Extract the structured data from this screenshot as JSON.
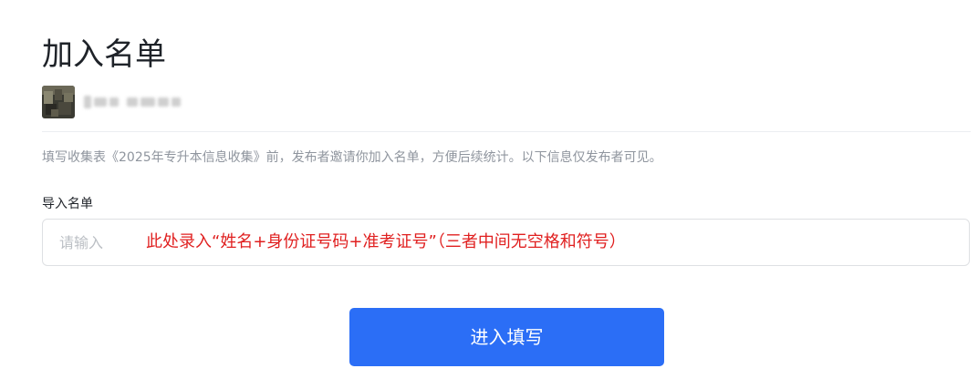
{
  "page": {
    "title": "加入名单"
  },
  "publisher": {
    "name_masked": true
  },
  "description": "填写收集表《2025年专升本信息收集》前，发布者邀请你加入名单，方便后续统计。以下信息仅发布者可见。",
  "field": {
    "label": "导入名单",
    "placeholder": "请输入",
    "annotation": "此处录入“姓名+身份证号码+准考证号”（三者中间无空格和符号）"
  },
  "submit": {
    "label": "进入填写"
  },
  "colors": {
    "primary": "#2b6ef6",
    "annotation": "#e02020",
    "muted_text": "#8f959e",
    "border": "#dee0e3"
  },
  "icons": {
    "avatar": "avatar-image"
  }
}
